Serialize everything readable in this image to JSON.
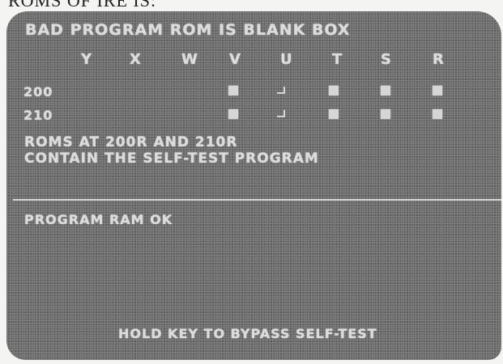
{
  "page_caption": "ROMS OF IRE IS:",
  "screen": {
    "title": "BAD PROGRAM ROM IS BLANK BOX",
    "columns": [
      "Y",
      "X",
      "W",
      "V",
      "U",
      "T",
      "S",
      "R"
    ],
    "rows": [
      {
        "label": "200",
        "cells": [
          "",
          "",
          "",
          "filled",
          "blank",
          "filled",
          "filled",
          "filled"
        ]
      },
      {
        "label": "210",
        "cells": [
          "",
          "",
          "",
          "filled",
          "blank",
          "filled",
          "filled",
          "filled"
        ]
      }
    ],
    "note_line1": "ROMS AT 200R AND 210R",
    "note_line2": "CONTAIN THE SELF-TEST PROGRAM",
    "status": "PROGRAM RAM OK",
    "footer": "HOLD KEY TO BYPASS SELF-TEST"
  },
  "colors": {
    "screen_bg": "#6c6c6c",
    "screen_text": "#dcdcdc"
  }
}
